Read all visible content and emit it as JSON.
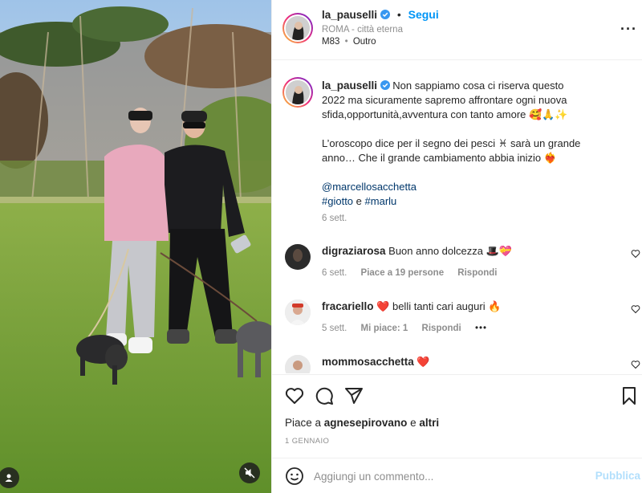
{
  "header": {
    "username": "la_pauselli",
    "follow_label": "Segui",
    "separator": "•",
    "location": "ROMA - città eterna",
    "music_artist": "M83",
    "music_track": "Outro",
    "music_separator": "•"
  },
  "caption": {
    "username": "la_pauselli",
    "line1": "Non sappiamo cosa ci riserva questo 2022 ma sicuramente sapremo affrontare ogni nuova sfida,opportunità,avventura con tanto amore 🥰🙏✨",
    "line2": "L’oroscopo dice per il segno dei pesci ♓ sarà un grande anno… Che il grande cambiamento abbia inizio ❤️‍🔥",
    "mention": "@marcellosacchetta",
    "hashtag1": "#giotto",
    "conj": "e",
    "hashtag2": "#marlu",
    "time": "6 sett."
  },
  "comments": [
    {
      "username": "digraziarosa",
      "text": "Buon anno dolcezza 🎩💝",
      "time": "6 sett.",
      "likes": "Piace a 19 persone",
      "reply": "Rispondi"
    },
    {
      "username": "fracariello",
      "text": "❤️ belli tanti cari auguri 🔥",
      "time": "5 sett.",
      "likes": "Mi piace: 1",
      "reply": "Rispondi",
      "more": "•••"
    },
    {
      "username": "mommosacchetta",
      "text": "❤️"
    }
  ],
  "actions": {
    "icons": [
      "heart-icon",
      "comment-icon",
      "share-icon",
      "bookmark-icon"
    ],
    "likes_prefix": "Piace a",
    "likes_user": "agnesepirovano",
    "likes_conj": "e",
    "likes_others": "altri",
    "date": "1 GENNAIO"
  },
  "add_comment": {
    "placeholder": "Aggiungi un commento...",
    "publish_label": "Pubblica"
  },
  "colors": {
    "accent": "#0095f6",
    "link": "#00376b",
    "muted": "#8e8e8e",
    "publish_disabled": "#b2dffc"
  }
}
